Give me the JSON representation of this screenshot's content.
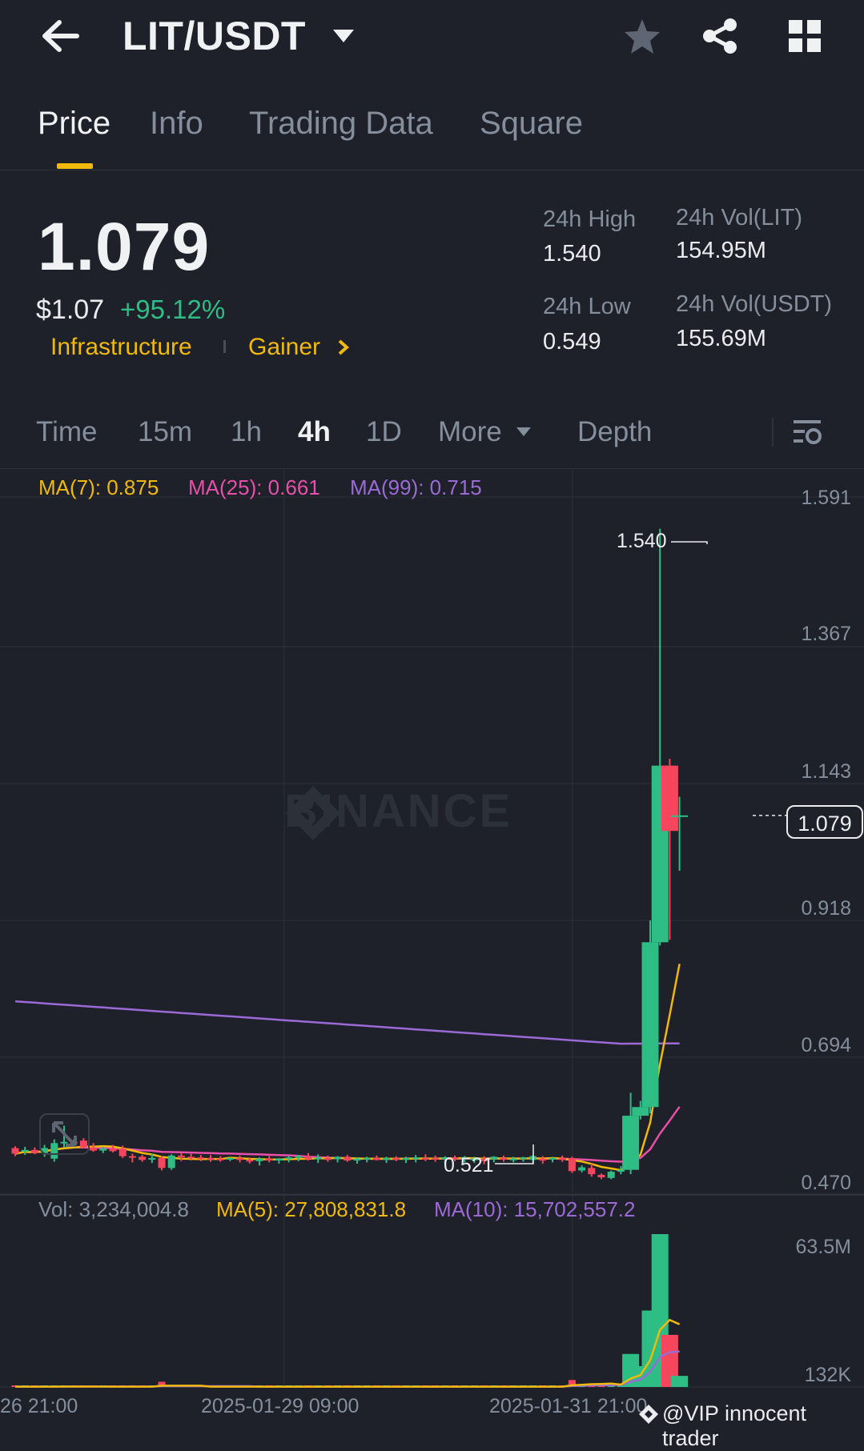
{
  "header": {
    "back_icon": "arrow-left-icon",
    "pair": "LIT/USDT",
    "pair_dropdown_icon": "caret-down-icon",
    "favorite_icon": "star-icon",
    "share_icon": "share-icon",
    "grid_icon": "grid-icon"
  },
  "tabs": [
    {
      "label": "Price",
      "active": true
    },
    {
      "label": "Info"
    },
    {
      "label": "Trading Data"
    },
    {
      "label": "Square"
    }
  ],
  "price": {
    "last": "1.079",
    "usd": "$1.07",
    "change": "+95.12%",
    "tags": [
      "Infrastructure",
      "Gainer"
    ]
  },
  "stats": {
    "high_label": "24h High",
    "high_value": "1.540",
    "low_label": "24h Low",
    "low_value": "0.549",
    "vol_base_label": "24h Vol(LIT)",
    "vol_base_value": "154.95M",
    "vol_quote_label": "24h Vol(USDT)",
    "vol_quote_value": "155.69M"
  },
  "intervals": {
    "items": [
      "Time",
      "15m",
      "1h",
      "4h",
      "1D",
      "More",
      "Depth"
    ],
    "active": "4h",
    "settings_icon": "chart-settings-icon"
  },
  "colors": {
    "up": "#2ebd85",
    "down": "#f6465d",
    "ma7": "#f0b90b",
    "ma25": "#e84fa8",
    "ma99": "#9c6ad6",
    "accent": "#f0b90b"
  },
  "chart_data": {
    "type": "candlestick",
    "ma_legend": {
      "ma7": "MA(7): 0.875",
      "ma25": "MA(25): 0.661",
      "ma99": "MA(99): 0.715"
    },
    "y_ticks": [
      "1.591",
      "1.367",
      "1.143",
      "0.918",
      "0.694",
      "0.470"
    ],
    "ylim": [
      0.47,
      1.591
    ],
    "last_price": "1.079",
    "annotations": {
      "high": "1.540",
      "low": "0.521"
    },
    "x_labels": [
      "26 21:00",
      "2025-01-29 09:00",
      "2025-01-31 21:00"
    ],
    "watermark": "BINANCE",
    "candles": [
      {
        "o": 0.544,
        "h": 0.547,
        "l": 0.531,
        "c": 0.535
      },
      {
        "o": 0.539,
        "h": 0.546,
        "l": 0.533,
        "c": 0.541
      },
      {
        "o": 0.541,
        "h": 0.545,
        "l": 0.534,
        "c": 0.536
      },
      {
        "o": 0.536,
        "h": 0.549,
        "l": 0.53,
        "c": 0.544
      },
      {
        "o": 0.527,
        "h": 0.558,
        "l": 0.522,
        "c": 0.552
      },
      {
        "o": 0.552,
        "h": 0.58,
        "l": 0.545,
        "c": 0.554
      },
      {
        "o": 0.554,
        "h": 0.558,
        "l": 0.549,
        "c": 0.552
      },
      {
        "o": 0.556,
        "h": 0.56,
        "l": 0.544,
        "c": 0.545
      },
      {
        "o": 0.545,
        "h": 0.552,
        "l": 0.538,
        "c": 0.54
      },
      {
        "o": 0.54,
        "h": 0.546,
        "l": 0.536,
        "c": 0.543
      },
      {
        "o": 0.543,
        "h": 0.549,
        "l": 0.537,
        "c": 0.539
      },
      {
        "o": 0.543,
        "h": 0.548,
        "l": 0.528,
        "c": 0.531
      },
      {
        "o": 0.531,
        "h": 0.535,
        "l": 0.521,
        "c": 0.53
      },
      {
        "o": 0.53,
        "h": 0.533,
        "l": 0.522,
        "c": 0.525
      },
      {
        "o": 0.526,
        "h": 0.535,
        "l": 0.52,
        "c": 0.528
      },
      {
        "o": 0.528,
        "h": 0.531,
        "l": 0.508,
        "c": 0.512
      },
      {
        "o": 0.512,
        "h": 0.534,
        "l": 0.509,
        "c": 0.532
      },
      {
        "o": 0.532,
        "h": 0.536,
        "l": 0.523,
        "c": 0.53
      },
      {
        "o": 0.53,
        "h": 0.535,
        "l": 0.524,
        "c": 0.529
      },
      {
        "o": 0.529,
        "h": 0.533,
        "l": 0.523,
        "c": 0.528
      },
      {
        "o": 0.528,
        "h": 0.533,
        "l": 0.522,
        "c": 0.527
      },
      {
        "o": 0.527,
        "h": 0.531,
        "l": 0.522,
        "c": 0.526
      },
      {
        "o": 0.526,
        "h": 0.53,
        "l": 0.523,
        "c": 0.528
      },
      {
        "o": 0.528,
        "h": 0.532,
        "l": 0.521,
        "c": 0.525
      },
      {
        "o": 0.525,
        "h": 0.529,
        "l": 0.519,
        "c": 0.523
      },
      {
        "o": 0.523,
        "h": 0.529,
        "l": 0.516,
        "c": 0.527
      },
      {
        "o": 0.527,
        "h": 0.531,
        "l": 0.521,
        "c": 0.524
      },
      {
        "o": 0.524,
        "h": 0.528,
        "l": 0.519,
        "c": 0.527
      },
      {
        "o": 0.527,
        "h": 0.531,
        "l": 0.521,
        "c": 0.529
      },
      {
        "o": 0.529,
        "h": 0.533,
        "l": 0.523,
        "c": 0.531
      },
      {
        "o": 0.531,
        "h": 0.536,
        "l": 0.524,
        "c": 0.526
      },
      {
        "o": 0.526,
        "h": 0.534,
        "l": 0.52,
        "c": 0.529
      },
      {
        "o": 0.528,
        "h": 0.532,
        "l": 0.522,
        "c": 0.525
      },
      {
        "o": 0.526,
        "h": 0.531,
        "l": 0.521,
        "c": 0.53
      },
      {
        "o": 0.53,
        "h": 0.533,
        "l": 0.522,
        "c": 0.524
      },
      {
        "o": 0.524,
        "h": 0.529,
        "l": 0.519,
        "c": 0.527
      },
      {
        "o": 0.526,
        "h": 0.53,
        "l": 0.521,
        "c": 0.528
      },
      {
        "o": 0.528,
        "h": 0.532,
        "l": 0.524,
        "c": 0.525
      },
      {
        "o": 0.525,
        "h": 0.53,
        "l": 0.52,
        "c": 0.528
      },
      {
        "o": 0.528,
        "h": 0.531,
        "l": 0.523,
        "c": 0.526
      },
      {
        "o": 0.526,
        "h": 0.53,
        "l": 0.52,
        "c": 0.528
      },
      {
        "o": 0.527,
        "h": 0.533,
        "l": 0.521,
        "c": 0.529
      },
      {
        "o": 0.528,
        "h": 0.534,
        "l": 0.523,
        "c": 0.527
      },
      {
        "o": 0.528,
        "h": 0.532,
        "l": 0.522,
        "c": 0.526
      },
      {
        "o": 0.526,
        "h": 0.531,
        "l": 0.519,
        "c": 0.529
      },
      {
        "o": 0.529,
        "h": 0.532,
        "l": 0.523,
        "c": 0.527
      },
      {
        "o": 0.526,
        "h": 0.531,
        "l": 0.521,
        "c": 0.529
      },
      {
        "o": 0.525,
        "h": 0.53,
        "l": 0.52,
        "c": 0.527
      },
      {
        "o": 0.527,
        "h": 0.531,
        "l": 0.518,
        "c": 0.523
      },
      {
        "o": 0.526,
        "h": 0.531,
        "l": 0.521,
        "c": 0.53
      },
      {
        "o": 0.528,
        "h": 0.532,
        "l": 0.522,
        "c": 0.526
      },
      {
        "o": 0.526,
        "h": 0.53,
        "l": 0.521,
        "c": 0.527
      },
      {
        "o": 0.527,
        "h": 0.53,
        "l": 0.522,
        "c": 0.529
      },
      {
        "o": 0.525,
        "h": 0.533,
        "l": 0.52,
        "c": 0.531
      },
      {
        "o": 0.527,
        "h": 0.531,
        "l": 0.519,
        "c": 0.524
      },
      {
        "o": 0.526,
        "h": 0.53,
        "l": 0.521,
        "c": 0.528
      },
      {
        "o": 0.528,
        "h": 0.532,
        "l": 0.522,
        "c": 0.525
      },
      {
        "o": 0.528,
        "h": 0.53,
        "l": 0.504,
        "c": 0.507
      },
      {
        "o": 0.508,
        "h": 0.516,
        "l": 0.505,
        "c": 0.513
      },
      {
        "o": 0.512,
        "h": 0.519,
        "l": 0.498,
        "c": 0.502
      },
      {
        "o": 0.501,
        "h": 0.503,
        "l": 0.494,
        "c": 0.497
      },
      {
        "o": 0.496,
        "h": 0.508,
        "l": 0.494,
        "c": 0.506
      },
      {
        "o": 0.506,
        "h": 0.515,
        "l": 0.502,
        "c": 0.509
      },
      {
        "o": 0.509,
        "h": 0.633,
        "l": 0.502,
        "c": 0.596
      },
      {
        "o": 0.596,
        "h": 0.62,
        "l": 0.59,
        "c": 0.61
      },
      {
        "o": 0.61,
        "h": 0.91,
        "l": 0.6,
        "c": 0.875
      },
      {
        "o": 0.875,
        "h": 1.54,
        "l": 0.87,
        "c": 1.159
      },
      {
        "o": 1.159,
        "h": 1.17,
        "l": 0.879,
        "c": 1.054
      },
      {
        "o": 1.079,
        "h": 1.109,
        "l": 0.99,
        "c": 1.079
      }
    ],
    "vol_legend": {
      "vol": "Vol: 3,234,004.8",
      "ma5": "MA(5): 27,808,831.8",
      "ma10": "MA(10): 15,702,557.2"
    },
    "vol_ticks": [
      "63.5M",
      "132K"
    ],
    "volume": [
      0.1,
      0.1,
      0.1,
      0.1,
      0.1,
      0.2,
      0.1,
      0.1,
      0.1,
      0.1,
      0.1,
      0.1,
      0.1,
      0.1,
      0.1,
      1.5,
      0.1,
      0.1,
      0.1,
      0.1,
      0.1,
      0.1,
      0.1,
      0.1,
      0.1,
      0.1,
      0.1,
      0.1,
      0.1,
      0.1,
      0.1,
      0.1,
      0.1,
      0.1,
      0.1,
      0.1,
      0.1,
      0.1,
      0.1,
      0.1,
      0.1,
      0.1,
      0.1,
      0.1,
      0.1,
      0.1,
      0.1,
      0.1,
      0.1,
      0.1,
      0.1,
      0.1,
      0.1,
      0.1,
      0.1,
      0.1,
      0.1,
      2.0,
      0.8,
      1.0,
      0.5,
      0.5,
      0.6,
      9.5,
      6.0,
      22.0,
      44.0,
      15.0,
      3.2
    ]
  },
  "credit": "@VIP innocent trader"
}
